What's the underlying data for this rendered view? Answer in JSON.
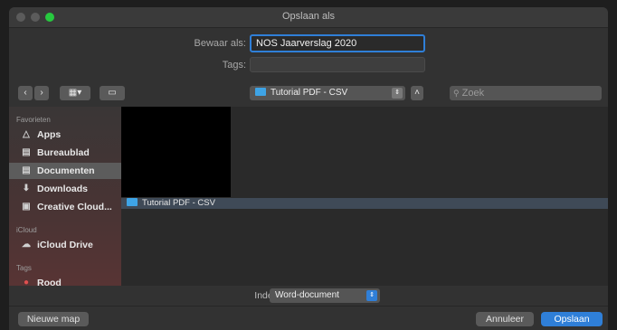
{
  "window": {
    "title": "Opslaan als"
  },
  "form": {
    "save_as_label": "Bewaar als:",
    "save_as_value": "NOS Jaarverslag 2020",
    "tags_label": "Tags:",
    "tags_value": ""
  },
  "toolbar": {
    "back_icon": "chevron-left-icon",
    "forward_icon": "chevron-right-icon",
    "view_icon": "column-view-icon",
    "new_folder_icon": "folder-icon",
    "location": "Tutorial PDF - CSV",
    "search_placeholder": "Zoek"
  },
  "sidebar": {
    "favorites_header": "Favorieten",
    "items": [
      {
        "label": "Apps"
      },
      {
        "label": "Bureaublad"
      },
      {
        "label": "Documenten",
        "selected": true
      },
      {
        "label": "Downloads"
      },
      {
        "label": "Creative Cloud..."
      }
    ],
    "icloud_header": "iCloud",
    "icloud_items": [
      {
        "label": "iCloud Drive"
      }
    ],
    "tags_header": "Tags",
    "tag_items": [
      {
        "label": "Rood",
        "color": "#e05050"
      }
    ]
  },
  "files": {
    "rows": [
      {
        "label": "Tutorial PDF - CSV"
      }
    ]
  },
  "format": {
    "label": "Indeling:",
    "value": "Word-document"
  },
  "footer": {
    "new_folder": "Nieuwe map",
    "cancel": "Annuleer",
    "save": "Opslaan"
  },
  "colors": {
    "accent": "#2f7fd8",
    "folder": "#3ea4e6"
  }
}
